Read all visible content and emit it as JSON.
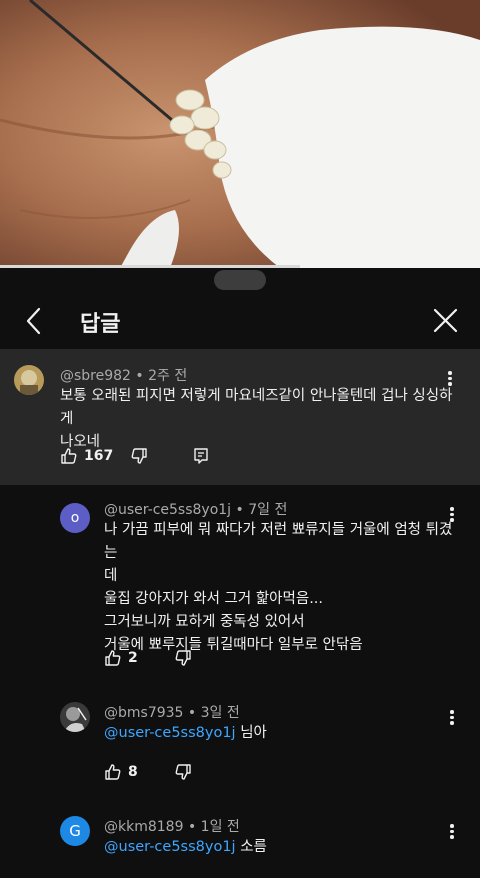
{
  "header": {
    "title": "답글"
  },
  "parent_comment": {
    "author": "@sbre982",
    "separator": "•",
    "time": "2주 전",
    "text_lines": [
      "보통 오래된 피지면 저렇게 마요네즈같이 안나올텐데 겁나 싱싱하게",
      "나오네"
    ],
    "likes": "167"
  },
  "replies": [
    {
      "author": "@user-ce5ss8yo1j",
      "separator": "•",
      "time": "7일 전",
      "avatar_letter": "o",
      "avatar_color": "#5c5ec6",
      "text_lines": [
        "나 가끔 피부에 뭐 짜다가 저런 뾰류지들 거울에 엄청 튀겼는",
        "데",
        "울집 강아지가 와서 그거 핥아먹음...",
        "그거보니까 묘하게 중독성 있어서",
        "거울에 뾰루지들 튀길때마다 일부로 안닦음"
      ],
      "likes": "2"
    },
    {
      "author": "@bms7935",
      "separator": "•",
      "time": "3일 전",
      "mention": "@user-ce5ss8yo1j",
      "text": "님아",
      "likes": "8"
    },
    {
      "author": "@kkm8189",
      "separator": "•",
      "time": "1일 전",
      "avatar_letter": "G",
      "avatar_color": "#1e88e5",
      "mention": "@user-ce5ss8yo1j",
      "text": "소름"
    }
  ],
  "colors": {
    "background": "#0f0f0f",
    "highlight": "#282828",
    "mention": "#3ea6ff",
    "meta": "#aaaaaa"
  }
}
